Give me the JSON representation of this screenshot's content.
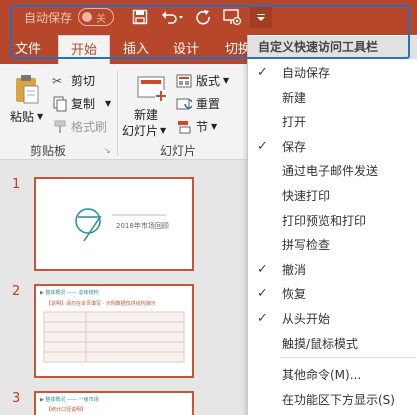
{
  "qat": {
    "autosave_label": "自动保存",
    "autosave_state": "关"
  },
  "tabs": [
    "文件",
    "开始",
    "插入",
    "设计",
    "切换"
  ],
  "ribbon": {
    "paste": "粘贴",
    "cut": "剪切",
    "copy": "复制",
    "format_painter": "格式刷",
    "clipboard_group": "剪贴板",
    "new_slide_line1": "新建",
    "new_slide_line2": "幻灯片",
    "layout": "版式",
    "reset": "重置",
    "section": "节",
    "slides_group": "幻灯片"
  },
  "slides": [
    {
      "number": "1",
      "subtitle": "2018年市场回顾"
    },
    {
      "number": "2",
      "heading": "▶ 整体概况 —— 总体结构",
      "banner": "【说明】请勿在本页填写 · 示例数据仅供结构演示"
    },
    {
      "number": "3",
      "heading": "▶ 整体概况 —— 一级市场",
      "banner": "【统计口径说明】"
    }
  ],
  "menu": {
    "header": "自定义快速访问工具栏",
    "items": [
      {
        "label": "自动保存",
        "checked": true
      },
      {
        "label": "新建",
        "checked": false
      },
      {
        "label": "打开",
        "checked": false
      },
      {
        "label": "保存",
        "checked": true
      },
      {
        "label": "通过电子邮件发送",
        "checked": false
      },
      {
        "label": "快速打印",
        "checked": false
      },
      {
        "label": "打印预览和打印",
        "checked": false
      },
      {
        "label": "拼写检查",
        "checked": false
      },
      {
        "label": "撤消",
        "checked": true
      },
      {
        "label": "恢复",
        "checked": true
      },
      {
        "label": "从头开始",
        "checked": true
      },
      {
        "label": "触摸/鼠标模式",
        "checked": false
      }
    ],
    "more_commands": "其他命令(M)...",
    "show_below": "在功能区下方显示(S)"
  },
  "colors": {
    "accent": "#b7472a",
    "highlight_border": "#2b6cc4",
    "slide_border": "#c8543a"
  }
}
